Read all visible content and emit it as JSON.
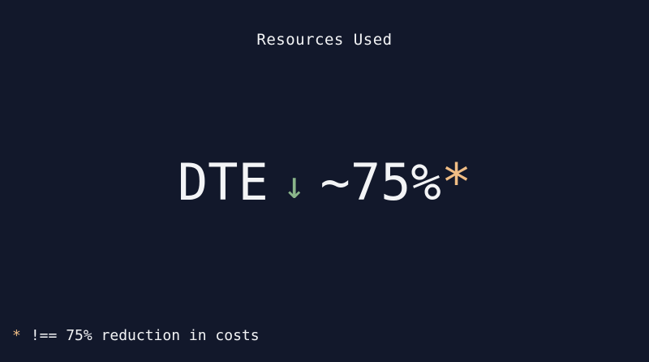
{
  "slide": {
    "title": "Resources Used",
    "headline": {
      "subject": "DTE",
      "arrow": "↓",
      "value": "~75%",
      "marker": "*"
    },
    "footnote": {
      "marker": "*",
      "text": "!== 75% reduction in costs"
    }
  },
  "colors": {
    "background": "#12182b",
    "text": "#f3f4f6",
    "arrow": "#8ab58a",
    "asterisk": "#f0bd85"
  }
}
